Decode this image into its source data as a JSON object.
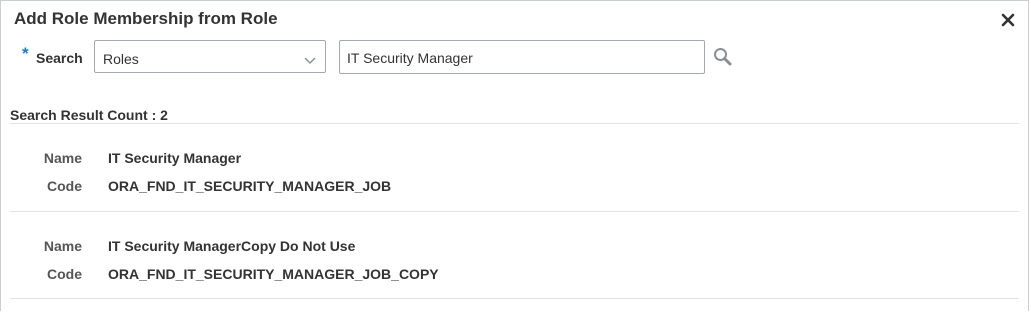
{
  "dialog": {
    "title": "Add Role Membership from Role",
    "close_icon": "close-icon"
  },
  "search": {
    "required_marker": "*",
    "label": "Search",
    "type_select": {
      "selected": "Roles",
      "icon": "chevron-down-icon"
    },
    "query": {
      "value": "IT Security Manager",
      "placeholder": ""
    },
    "button_icon": "search-icon"
  },
  "results": {
    "count_text": "Search Result Count : 2",
    "items": [
      {
        "name_label": "Name",
        "name": "IT Security Manager",
        "code_label": "Code",
        "code": "ORA_FND_IT_SECURITY_MANAGER_JOB"
      },
      {
        "name_label": "Name",
        "name": "IT Security ManagerCopy Do Not Use",
        "code_label": "Code",
        "code": "ORA_FND_IT_SECURITY_MANAGER_JOB_COPY"
      }
    ]
  },
  "colors": {
    "required": "#1c7bcb",
    "text": "#333333",
    "border": "#a3a9ae",
    "divider": "#dfe3e6"
  }
}
